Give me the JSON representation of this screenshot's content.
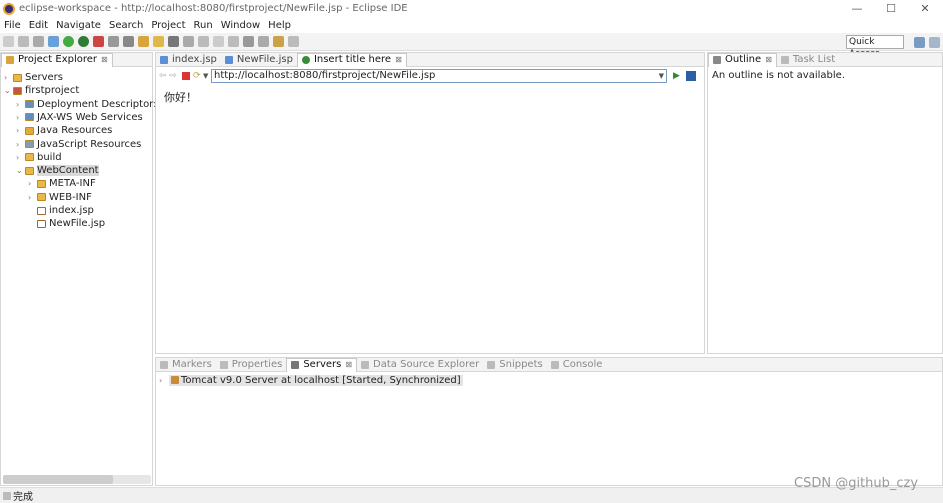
{
  "window": {
    "title": "eclipse-workspace - http://localhost:8080/firstproject/NewFile.jsp - Eclipse IDE",
    "minimize": "—",
    "maximize": "☐",
    "close": "✕"
  },
  "menu": [
    "File",
    "Edit",
    "Navigate",
    "Search",
    "Project",
    "Run",
    "Window",
    "Help"
  ],
  "toolbar": {
    "quick_access": "Quick Access"
  },
  "project_explorer": {
    "tab_label": "Project Explorer",
    "items": [
      {
        "label": "Servers",
        "level": 0,
        "chevron": "›",
        "icon": "folder"
      },
      {
        "label": "firstproject",
        "level": 0,
        "chevron": "⌄",
        "icon": "project"
      },
      {
        "label": "Deployment Descriptor: fir",
        "level": 1,
        "chevron": "›",
        "icon": "descriptor"
      },
      {
        "label": "JAX-WS Web Services",
        "level": 1,
        "chevron": "›",
        "icon": "webservice"
      },
      {
        "label": "Java Resources",
        "level": 1,
        "chevron": "›",
        "icon": "java"
      },
      {
        "label": "JavaScript Resources",
        "level": 1,
        "chevron": "›",
        "icon": "js"
      },
      {
        "label": "build",
        "level": 1,
        "chevron": "›",
        "icon": "folder"
      },
      {
        "label": "WebContent",
        "level": 1,
        "chevron": "⌄",
        "icon": "folder",
        "selected": true
      },
      {
        "label": "META-INF",
        "level": 2,
        "chevron": "›",
        "icon": "folder"
      },
      {
        "label": "WEB-INF",
        "level": 2,
        "chevron": "›",
        "icon": "folder"
      },
      {
        "label": "index.jsp",
        "level": 2,
        "chevron": "",
        "icon": "file"
      },
      {
        "label": "NewFile.jsp",
        "level": 2,
        "chevron": "",
        "icon": "file"
      }
    ]
  },
  "editor": {
    "tabs": [
      {
        "label": "index.jsp",
        "active": false
      },
      {
        "label": "NewFile.jsp",
        "active": false
      },
      {
        "label": "Insert title here",
        "active": true
      }
    ],
    "url": "http://localhost:8080/firstproject/NewFile.jsp",
    "content": "你好！"
  },
  "outline": {
    "tab_label": "Outline",
    "tab2_label": "Task List",
    "message": "An outline is not available."
  },
  "bottom": {
    "tabs": [
      {
        "label": "Markers",
        "active": false
      },
      {
        "label": "Properties",
        "active": false
      },
      {
        "label": "Servers",
        "active": true
      },
      {
        "label": "Data Source Explorer",
        "active": false
      },
      {
        "label": "Snippets",
        "active": false
      },
      {
        "label": "Console",
        "active": false
      }
    ],
    "server_row": "Tomcat v9.0 Server at localhost  [Started, Synchronized]"
  },
  "status": {
    "text": "完成"
  },
  "watermark": "CSDN @github_czy"
}
